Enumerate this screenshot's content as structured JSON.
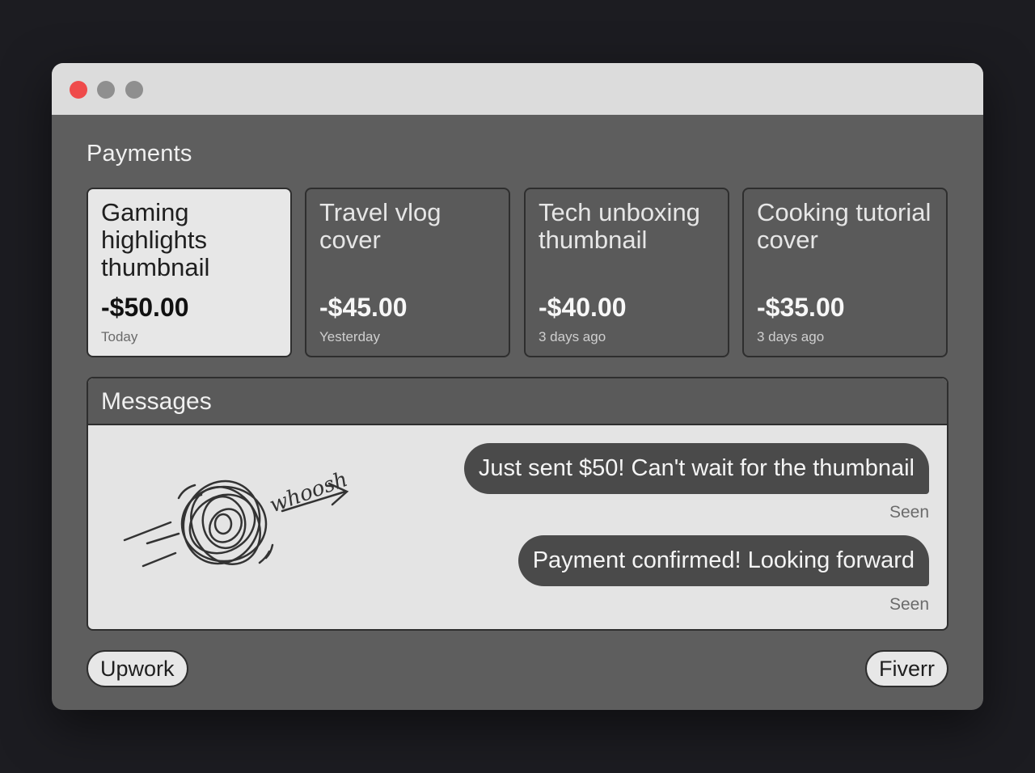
{
  "payments": {
    "title": "Payments",
    "cards": [
      {
        "title": "Gaming highlights thumbnail",
        "amount": "-$50.00",
        "date": "Today"
      },
      {
        "title": "Travel vlog cover",
        "amount": "-$45.00",
        "date": "Yesterday"
      },
      {
        "title": "Tech unboxing thumbnail",
        "amount": "-$40.00",
        "date": "3 days ago"
      },
      {
        "title": "Cooking tutorial cover",
        "amount": "-$35.00",
        "date": "3 days ago"
      }
    ]
  },
  "messages": {
    "title": "Messages",
    "doodle_text": "whoosh",
    "items": [
      {
        "text": "Just sent $50! Can't wait for the thumbnail",
        "status": "Seen"
      },
      {
        "text": "Payment confirmed! Looking forward",
        "status": "Seen"
      }
    ]
  },
  "footer": {
    "left_label": "Upwork",
    "right_label": "Fiverr"
  },
  "colors": {
    "close_dot": "#ef4b4b",
    "window_body": "#5e5e5e",
    "active_card": "#e7e7e7"
  }
}
